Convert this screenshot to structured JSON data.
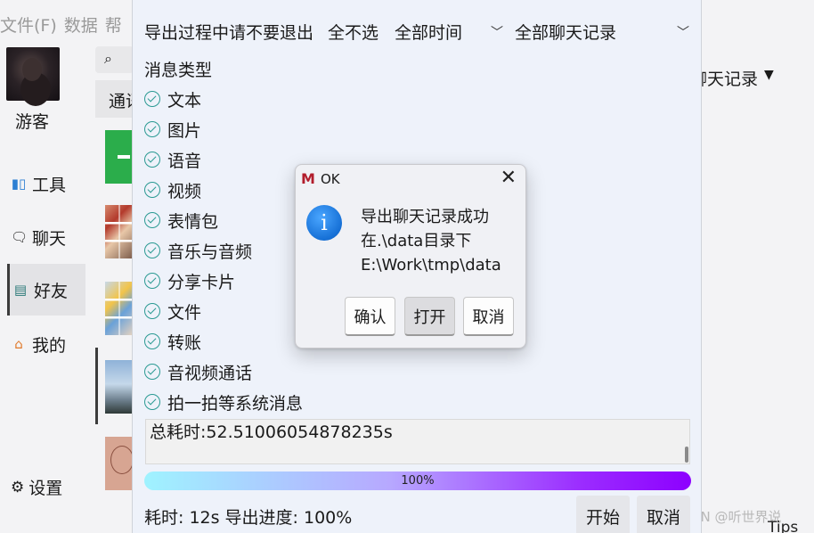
{
  "menubar": {
    "file": "文件(F)",
    "data": "数据",
    "help": "帮"
  },
  "sidebar": {
    "username": "游客",
    "items": [
      {
        "label": "工具",
        "icon": "tools-icon"
      },
      {
        "label": "聊天",
        "icon": "chat-icon"
      },
      {
        "label": "好友",
        "icon": "contacts-icon"
      },
      {
        "label": "我的",
        "icon": "home-icon"
      }
    ],
    "settings_label": "设置"
  },
  "middle": {
    "search_icon": "⌕",
    "tab_label": "通讯录"
  },
  "background_right": {
    "title": "聊天记录",
    "caret": "▼"
  },
  "export_panel": {
    "status_text": "导出过程中请不要退出",
    "deselect_all": "全不选",
    "time_range": "全部时间",
    "record_range": "全部聊天记录",
    "msg_types_title": "消息类型",
    "msg_types": [
      "文本",
      "图片",
      "语音",
      "视频",
      "表情包",
      "音乐与音频",
      "分享卡片",
      "文件",
      "转账",
      "音视频通话",
      "拍一拍等系统消息"
    ],
    "log_text": "总耗时:52.51006054878235s",
    "progress": {
      "value": 100,
      "label": "100%"
    },
    "footer_status": "耗时: 12s 导出进度: 100%",
    "start_button": "开始",
    "cancel_button": "取消"
  },
  "msgbox": {
    "title": "OK",
    "logo": "M",
    "lines": [
      "导出聊天记录成功",
      "在.\\data目录下",
      "E:\\Work\\tmp\\data"
    ],
    "confirm": "确认",
    "open": "打开",
    "cancel": "取消"
  },
  "watermark": "CSDN @听世界说",
  "tips": "Tips",
  "colors": {
    "check": "#2b9a93",
    "info_icon": "#1670d6",
    "progress_start": "#9ff3ff",
    "progress_end": "#8d00ff"
  }
}
